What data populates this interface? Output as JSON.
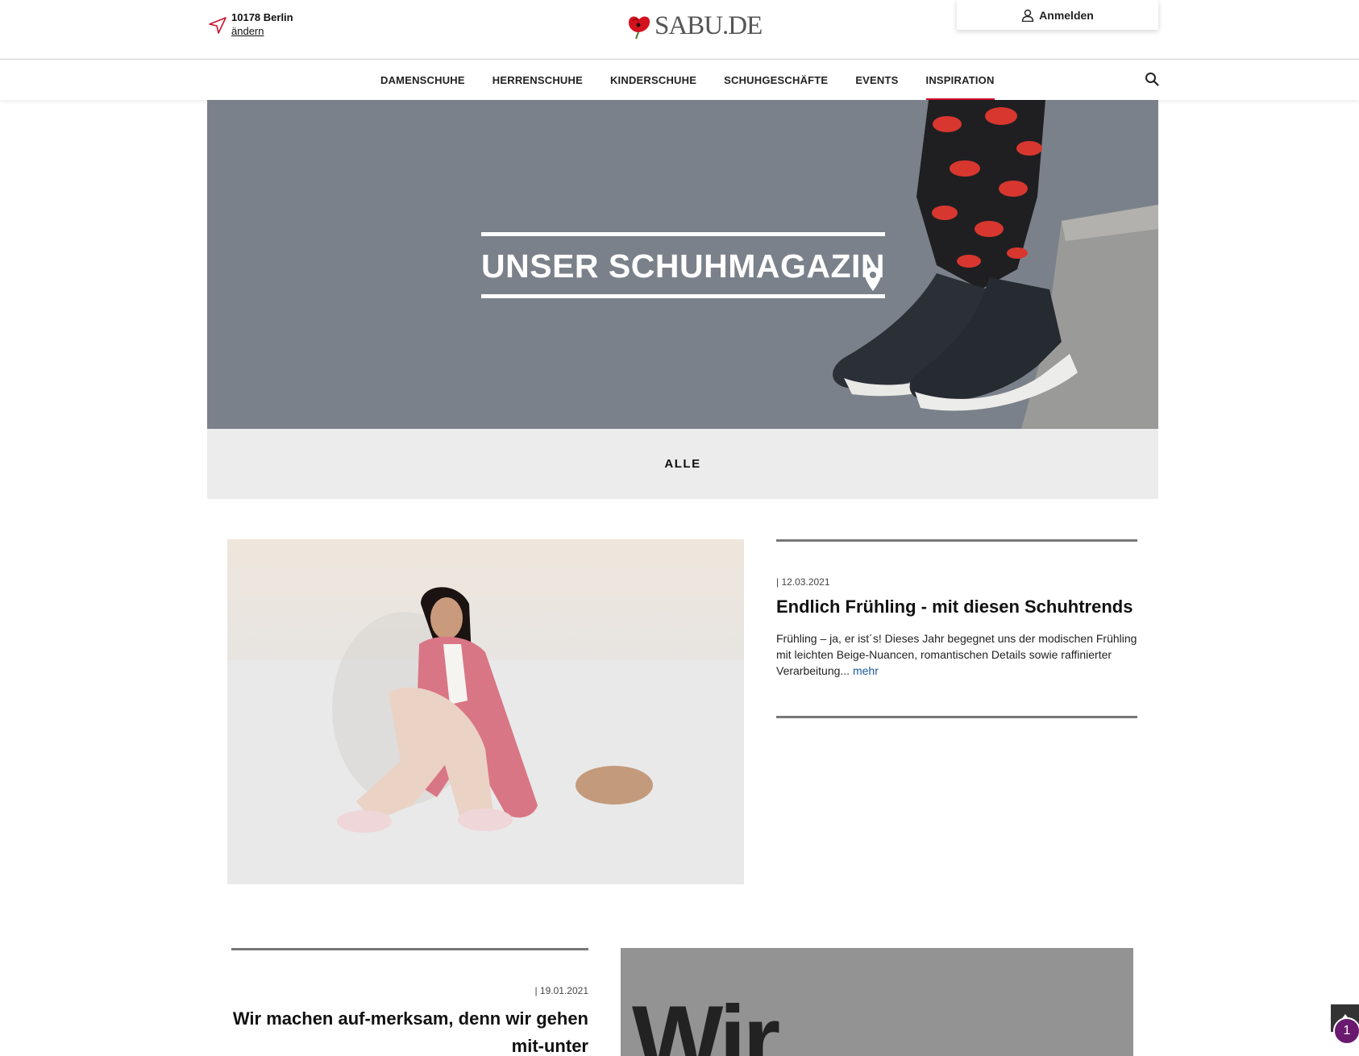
{
  "header": {
    "location": {
      "city": "10178 Berlin",
      "change_label": "ändern",
      "icon": "location-arrow-icon"
    },
    "logo_text": "SABU.DE",
    "login_label": "Anmelden"
  },
  "nav": {
    "items": [
      {
        "label": "DAMENSCHUHE",
        "active": false
      },
      {
        "label": "HERRENSCHUHE",
        "active": false
      },
      {
        "label": "KINDERSCHUHE",
        "active": false
      },
      {
        "label": "SCHUHGESCHÄFTE",
        "active": false
      },
      {
        "label": "EVENTS",
        "active": false
      },
      {
        "label": "INSPIRATION",
        "active": true
      }
    ],
    "accent_color": "#c8102e"
  },
  "hero": {
    "title": "UNSER SCHUHMAGAZIN"
  },
  "filter": {
    "all_label": "ALLE"
  },
  "articles": [
    {
      "date": "| 12.03.2021",
      "title": "Endlich Frühling - mit diesen Schuhtrends",
      "excerpt": "Frühling – ja, er ist´s! Dieses Jahr begegnet uns der modischen Frühling mit leichten Beige-Nuancen, romantischen Details sowie raffinierter Verarbeitung...",
      "more_label": "mehr"
    },
    {
      "date": "| 19.01.2021",
      "title": "Wir machen auf-merksam, denn wir gehen mit-unter",
      "image_word": "Wir"
    }
  ],
  "floating": {
    "notification_count": "1"
  }
}
